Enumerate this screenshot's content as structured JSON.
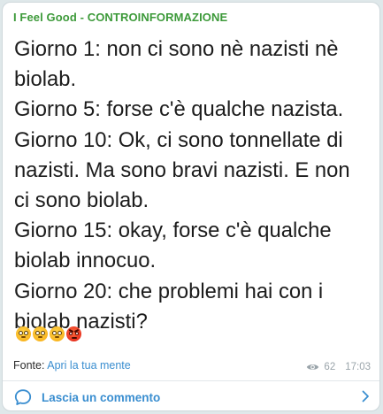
{
  "post": {
    "channel_name": "I Feel Good - CONTROINFORMAZIONE",
    "lines": [
      "Giorno 1: non ci sono nè nazisti nè",
      "biolab.",
      "Giorno 5: forse c'è qualche nazista.",
      "Giorno 10: Ok, ci sono tonnellate di",
      "nazisti. Ma sono bravi nazisti. E non",
      "ci sono biolab.",
      "Giorno 15: okay, forse c'è qualche",
      "biolab innocuo.",
      "Giorno 20: che problemi hai con i",
      "biolab nazisti?"
    ],
    "emojis": [
      "flushed-face",
      "flushed-face",
      "flushed-face",
      "angry-face"
    ],
    "source_label": "Fonte:",
    "source_link": "Apri la tua mente",
    "views": "62",
    "time": "17:03"
  },
  "comments": {
    "label": "Lascia un commento"
  },
  "colors": {
    "channel": "#3d9a3a",
    "link": "#3a8ed0",
    "meta": "#9aa4aa"
  }
}
